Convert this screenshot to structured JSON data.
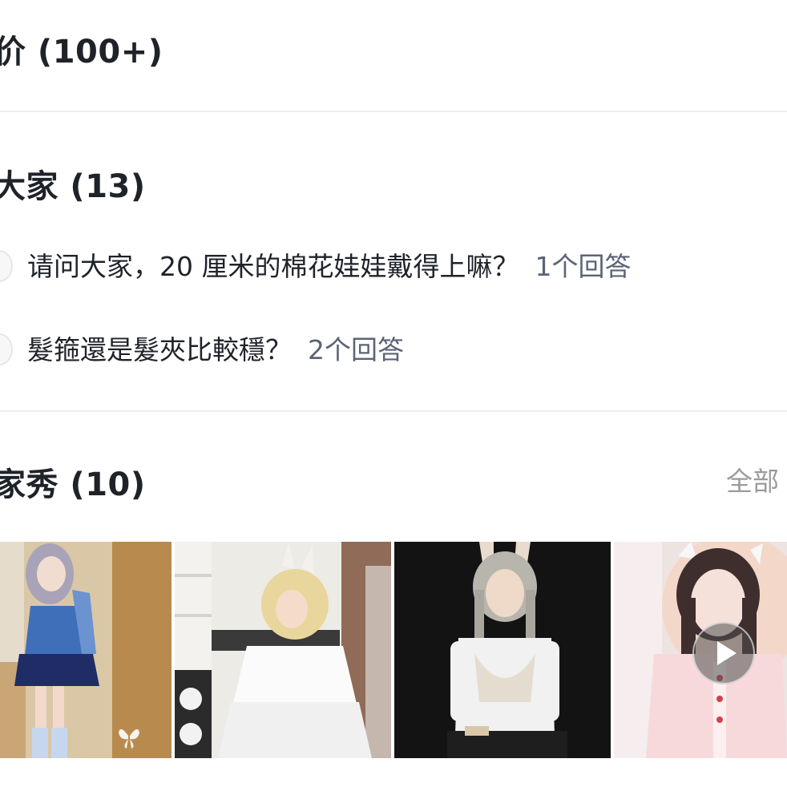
{
  "reviews": {
    "title": "价 (100+)"
  },
  "ask": {
    "title": "大家 (13)",
    "questions": [
      {
        "text": "请问大家，20 厘米的棉花娃娃戴得上嘛？",
        "answers": "1个回答"
      },
      {
        "text": "髮箍還是髮夾比較穩？",
        "answers": "2个回答"
      }
    ]
  },
  "buyer_show": {
    "title": "家秀 (10)",
    "see_all": "全部",
    "photos": [
      {
        "icon": "butterfly-icon"
      },
      {
        "icon": ""
      },
      {
        "icon": ""
      },
      {
        "icon": "play-icon"
      }
    ]
  },
  "colors": {
    "title": "#1f2329",
    "answer_count": "#5b6477",
    "see_all": "#9b9b9b",
    "divider": "#ededed"
  }
}
